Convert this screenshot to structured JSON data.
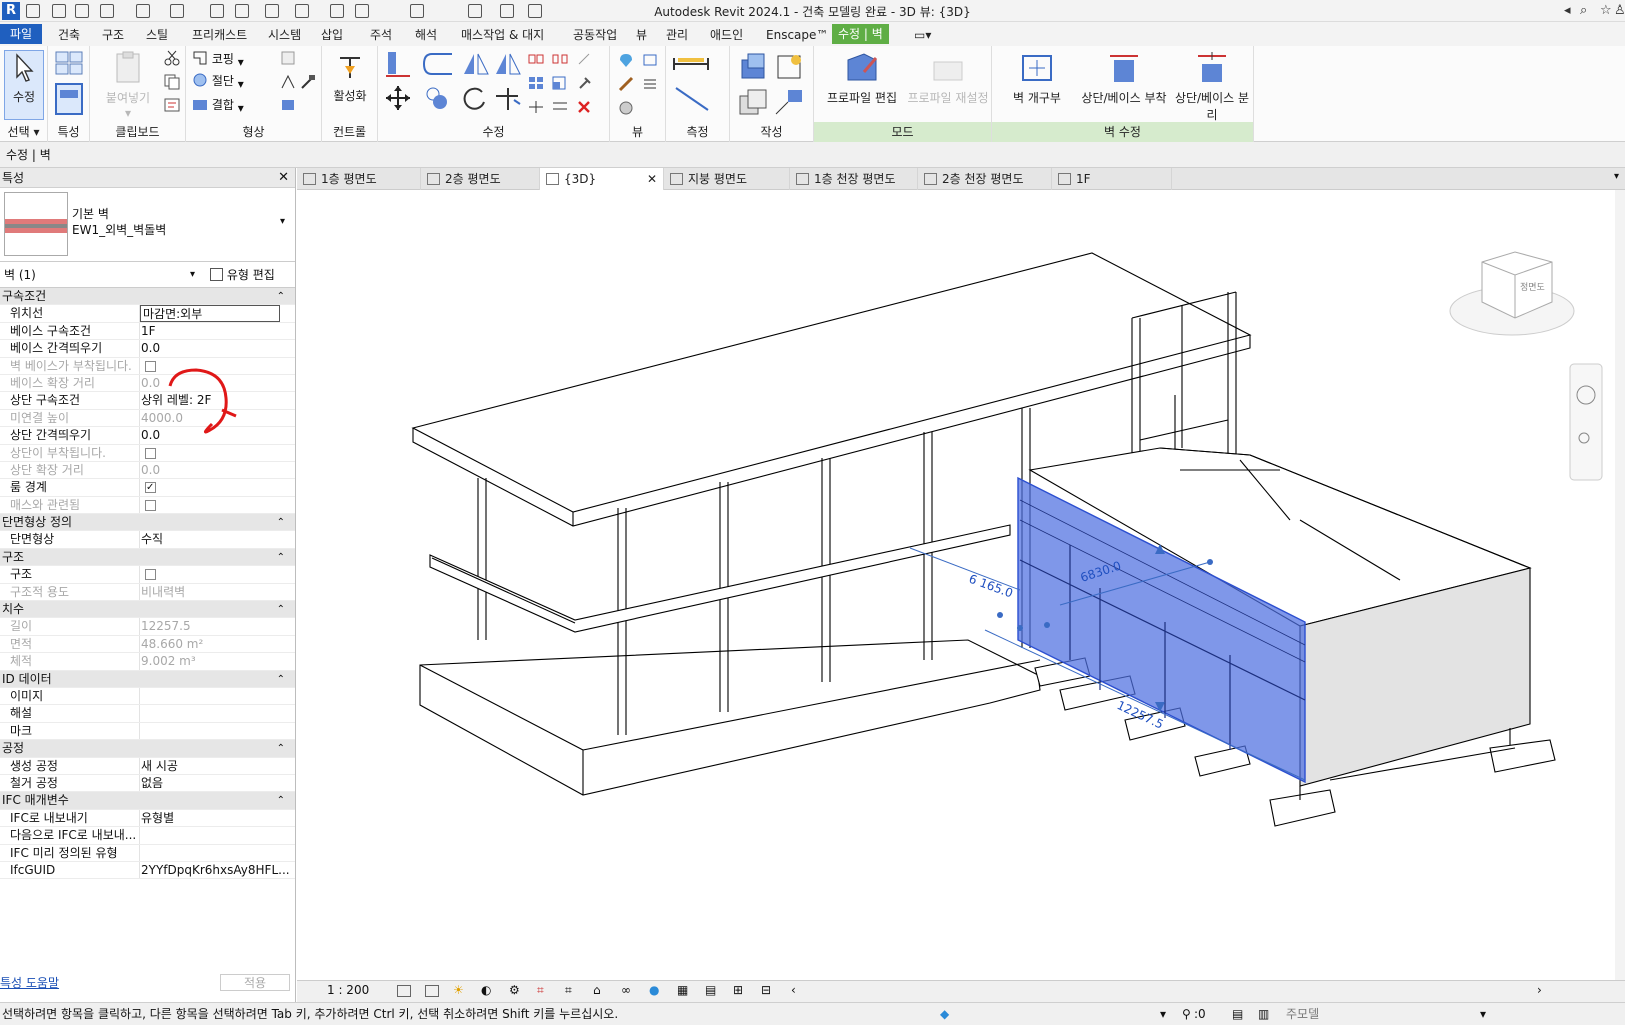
{
  "app": {
    "title": "Autodesk Revit 2024.1 - 건축 모델링 완료 - 3D 뷰: {3D}",
    "logo": "R"
  },
  "ribbon_tabs": [
    "파일",
    "건축",
    "구조",
    "스틸",
    "프리캐스트",
    "시스템",
    "삽입",
    "주석",
    "해석",
    "매스작업 & 대지",
    "공동작업",
    "뷰",
    "관리",
    "애드인",
    "Enscape™",
    "수정 | 벽"
  ],
  "ribbon": {
    "select": {
      "modify_label": "수정",
      "group_label": "선택"
    },
    "properties": {
      "group_label": "특성"
    },
    "clipboard": {
      "paste_label": "붙여넣기",
      "group_label": "클립보드"
    },
    "geometry": {
      "cope": "코핑",
      "cut": "절단",
      "join": "결합",
      "group_label": "형상"
    },
    "controls": {
      "activate_label": "활성화",
      "group_label": "컨트롤"
    },
    "modify": {
      "group_label": "수정"
    },
    "view": {
      "group_label": "뷰"
    },
    "measure": {
      "group_label": "측정"
    },
    "create": {
      "group_label": "작성"
    },
    "mode": {
      "edit_profile": "프로파일 편집",
      "reset_profile": "프로파일 재설정",
      "group_label": "모드"
    },
    "modify_wall": {
      "wall_opening": "벽 개구부",
      "attach_top_base": "상단/베이스 부착",
      "detach_top_base": "상단/베이스 분리",
      "group_label": "벽 수정"
    }
  },
  "options_bar": {
    "text": "수정 | 벽"
  },
  "properties_panel": {
    "title": "특성",
    "type_family": "기본 벽",
    "type_name": "EW1_외벽_벽돌벽",
    "selection": "벽 (1)",
    "edit_type": "유형 편집",
    "rows": [
      {
        "kind": "sec",
        "k": "구속조건"
      },
      {
        "kind": "box",
        "k": "위치선",
        "v": "마감면:외부"
      },
      {
        "kind": "row",
        "k": "베이스 구속조건",
        "v": "1F"
      },
      {
        "kind": "row",
        "k": "베이스 간격띄우기",
        "v": "0.0"
      },
      {
        "kind": "cbdis",
        "k": "벽 베이스가 부착됩니다."
      },
      {
        "kind": "dis",
        "k": "베이스 확장 거리",
        "v": "0.0"
      },
      {
        "kind": "row",
        "k": "상단 구속조건",
        "v": "상위 레벨: 2F"
      },
      {
        "kind": "dis",
        "k": "미연결 높이",
        "v": "4000.0"
      },
      {
        "kind": "row",
        "k": "상단 간격띄우기",
        "v": "0.0"
      },
      {
        "kind": "cbdis",
        "k": "상단이 부착됩니다."
      },
      {
        "kind": "dis",
        "k": "상단 확장 거리",
        "v": "0.0"
      },
      {
        "kind": "cbon",
        "k": "룸 경계"
      },
      {
        "kind": "cbdis",
        "k": "매스와 관련됨"
      },
      {
        "kind": "sec",
        "k": "단면형상 정의"
      },
      {
        "kind": "row",
        "k": "단면형상",
        "v": "수직"
      },
      {
        "kind": "sec",
        "k": "구조"
      },
      {
        "kind": "cb",
        "k": "구조"
      },
      {
        "kind": "dis",
        "k": "구조적 용도",
        "v": "비내력벽"
      },
      {
        "kind": "sec",
        "k": "치수"
      },
      {
        "kind": "dis",
        "k": "길이",
        "v": "12257.5"
      },
      {
        "kind": "dis",
        "k": "면적",
        "v": "48.660 m²"
      },
      {
        "kind": "dis",
        "k": "체적",
        "v": "9.002 m³"
      },
      {
        "kind": "sec",
        "k": "ID 데이터"
      },
      {
        "kind": "row",
        "k": "이미지",
        "v": ""
      },
      {
        "kind": "row",
        "k": "해설",
        "v": ""
      },
      {
        "kind": "row",
        "k": "마크",
        "v": ""
      },
      {
        "kind": "sec",
        "k": "공정"
      },
      {
        "kind": "row",
        "k": "생성 공정",
        "v": "새 시공"
      },
      {
        "kind": "row",
        "k": "철거 공정",
        "v": "없음"
      },
      {
        "kind": "sec",
        "k": "IFC 매개변수"
      },
      {
        "kind": "row",
        "k": "IFC로 내보내기",
        "v": "유형별"
      },
      {
        "kind": "row",
        "k": "다음으로 IFC로 내보내...",
        "v": ""
      },
      {
        "kind": "row",
        "k": "IFC 미리 정의된 유형",
        "v": ""
      },
      {
        "kind": "row",
        "k": "IfcGUID",
        "v": "2YYfDpqKr6hxsAy8HFL..."
      }
    ],
    "help_link": "특성 도움말",
    "apply": "적용"
  },
  "view_tabs": [
    {
      "label": "1층 평면도",
      "active": false
    },
    {
      "label": "2층 평면도",
      "active": false
    },
    {
      "label": "{3D}",
      "active": true
    },
    {
      "label": "지붕 평면도",
      "active": false
    },
    {
      "label": "1층 천장 평면도",
      "active": false
    },
    {
      "label": "2층 천장 평면도",
      "active": false
    },
    {
      "label": "1F",
      "active": false
    }
  ],
  "viewcube": {
    "face": "정면도"
  },
  "dimensions": {
    "d1": "6 165.0",
    "d2": "6830.0",
    "d3": "12257.5"
  },
  "view_control_bar": {
    "scale": "1 : 200"
  },
  "status_bar": {
    "message": "선택하려면 항목을 클릭하고, 다른 항목을 선택하려면 Tab 키, 추가하려면 Ctrl 키, 선택 취소하려면 Shift 키를 누르십시오.",
    "filter_count": ":0",
    "model": "주모델"
  },
  "colors": {
    "accent": "#1f5fbf",
    "context_tab": "#5fae45",
    "selection": "#4d6fe0",
    "annotation": "#e01818"
  }
}
